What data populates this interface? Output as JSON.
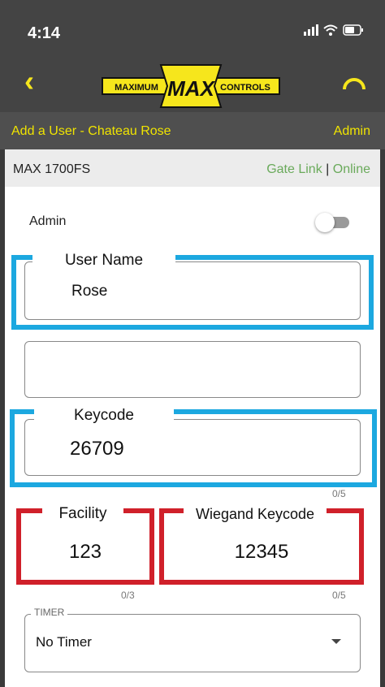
{
  "status": {
    "time": "4:14",
    "icons": [
      "signal-icon",
      "wifi-icon",
      "battery-icon"
    ]
  },
  "nav": {
    "back_icon": "chevron-left-icon",
    "refresh_icon": "refresh-arc-icon",
    "logo": {
      "left": "MAXIMUM",
      "center": "MAX",
      "right": "CONTROLS"
    }
  },
  "subheader": {
    "title": "Add a User - Chateau Rose",
    "role": "Admin"
  },
  "device": {
    "model": "MAX 1700FS",
    "link": "Gate Link",
    "separator": "|",
    "status": "Online"
  },
  "admin": {
    "label": "Admin",
    "enabled": false
  },
  "form": {
    "user_name": {
      "label": "User Name",
      "value": "Rose"
    },
    "second_field": {
      "value": ""
    },
    "keycode": {
      "label": "Keycode",
      "value": "26709",
      "counter": "0/5"
    },
    "facility": {
      "label": "Facility",
      "value": "123",
      "counter": "0/3"
    },
    "wiegand": {
      "label": "Wiegand Keycode",
      "value": "12345",
      "counter": "0/5"
    },
    "timer": {
      "legend": "TIMER",
      "value": "No Timer"
    }
  },
  "colors": {
    "header_bg": "#444444",
    "accent_yellow": "#f0e400",
    "online_green": "#6aaa5b",
    "highlight_blue": "#1ca8e0",
    "highlight_red": "#d0202a"
  }
}
